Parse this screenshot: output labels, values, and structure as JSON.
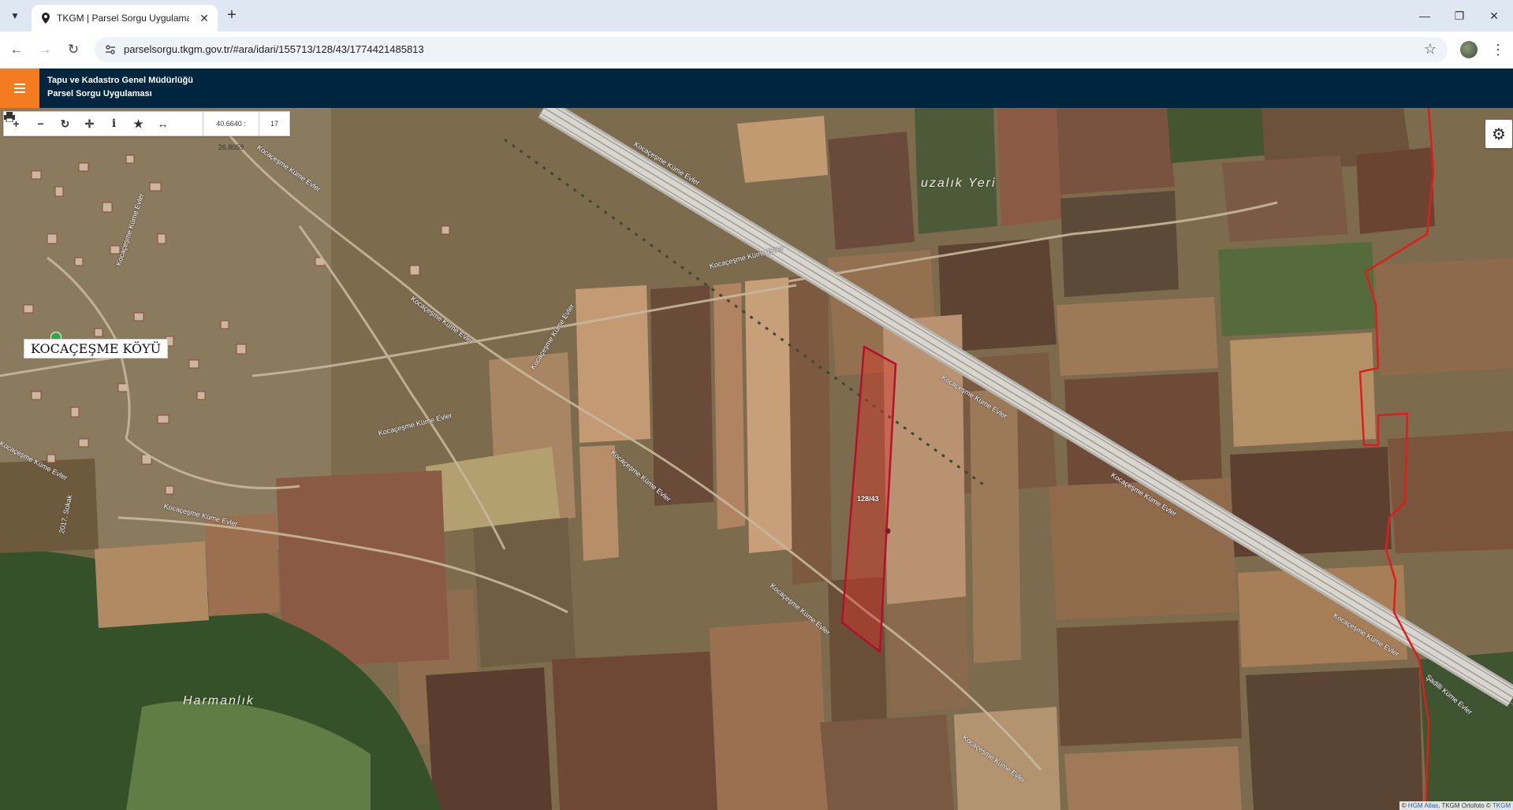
{
  "browser": {
    "tab_title": "TKGM | Parsel Sorgu Uygulaması",
    "url": "parselsorgu.tkgm.gov.tr/#ara/idari/155713/128/43/1774421485813",
    "icons": {
      "tab_list": "chevron-down-icon",
      "tab_close": "close-icon",
      "new_tab": "plus-icon",
      "back": "arrow-left-icon",
      "forward": "arrow-right-icon",
      "reload": "reload-icon",
      "bookmark": "star-icon",
      "menu": "kebab-menu-icon"
    }
  },
  "app": {
    "org_name": "Tapu ve Kadastro Genel Müdürlüğü",
    "app_name": "Parsel Sorgu Uygulaması",
    "accent_color": "#f47b20",
    "header_color": "#00253e"
  },
  "map": {
    "coordinates": "40.6640 : 26.8059",
    "zoom_level": "17",
    "village_label": "KOCAÇEŞME KÖYÜ",
    "place_labels": [
      "uzalık Yeri",
      "Harmanlık"
    ],
    "road_labels": [
      "Kocaçeşme Küme Evler",
      "Kocaçeşme Küme Evler",
      "Kocaçeşme Küme Evler",
      "Kocaçeşme Küme Evler",
      "Kocaçeşme Küme Evler",
      "Kocaçeşme Küme Evler",
      "Kocaçeşme Küme Evler",
      "Kocaçeşme Küme Evler",
      "Kocaçeşme Küme Evler",
      "Kocaçeşme Küme Evler",
      "Kocaçeşme Küme Evler",
      "Kocaçeşme Küme Evler",
      "Şadilli Küme Evler",
      "2017. Sokak"
    ],
    "parcel_label": "128/43",
    "parcel_color": "#c0142c",
    "boundary_color": "#e21b1b",
    "attribution_prefix": "©",
    "attribution_link": "HGM Atlas",
    "attribution_rest": ", TKGM Ortofoto ©",
    "attribution_end": "TKGM",
    "tools": [
      "plus-icon",
      "minus-icon",
      "refresh-icon",
      "crosshair-icon",
      "info-icon",
      "star-icon",
      "measure-icon",
      "print-icon"
    ],
    "settings_icon": "gear-icon"
  }
}
